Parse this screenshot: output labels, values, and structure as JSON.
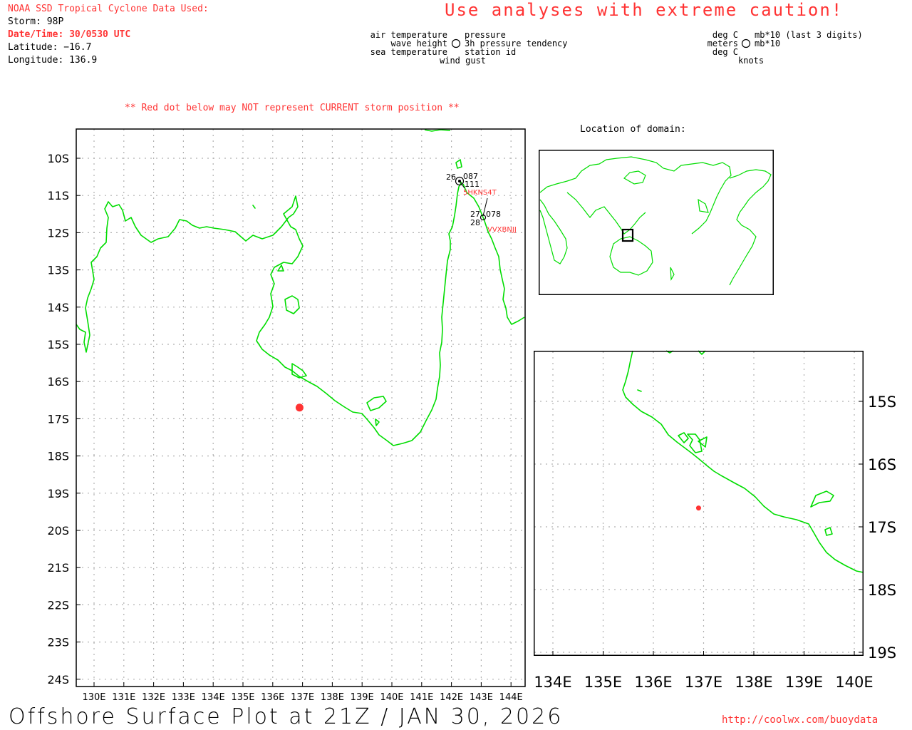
{
  "header": {
    "source_line": "NOAA SSD Tropical Cyclone Data Used:",
    "storm": "Storm: 98P",
    "datetime": "Date/Time: 30/0530 UTC",
    "latitude": "Latitude: −16.7",
    "longitude": "Longitude: 136.9",
    "caution": "Use analyses with extreme caution!",
    "red_dot_note": "** Red dot below may NOT represent CURRENT storm position **"
  },
  "legend_center": {
    "left": [
      "air temperature",
      "wave height",
      "sea temperature"
    ],
    "right": [
      "pressure",
      "3h pressure tendency",
      "station id"
    ],
    "bottom": "wind gust"
  },
  "legend_units": {
    "left": [
      "deg C",
      "meters",
      "deg C"
    ],
    "right": [
      "mb*10 (last 3 digits)",
      "mb*10"
    ],
    "bottom": "knots"
  },
  "main_map": {
    "lat_ticks": [
      "10S",
      "11S",
      "12S",
      "13S",
      "14S",
      "15S",
      "16S",
      "17S",
      "18S",
      "19S",
      "20S",
      "21S",
      "22S",
      "23S",
      "24S"
    ],
    "lon_ticks": [
      "130E",
      "131E",
      "132E",
      "133E",
      "134E",
      "135E",
      "136E",
      "137E",
      "138E",
      "139E",
      "140E",
      "141E",
      "142E",
      "143E",
      "144E"
    ],
    "storm_marker": {
      "lat": -16.7,
      "lon": 136.9,
      "color": "#ff3333"
    },
    "stations": [
      {
        "id": "5HKNS4T",
        "air_temp": "26",
        "pressure": "087",
        "tendency": "111"
      },
      {
        "id": "VVXBNJJ",
        "air_temp": "27",
        "sea_temp": "28",
        "pressure": "078"
      }
    ]
  },
  "location_map": {
    "title": "Location of domain:"
  },
  "zoom_map": {
    "lat_ticks": [
      "15S",
      "16S",
      "17S",
      "18S",
      "19S"
    ],
    "lon_ticks": [
      "134E",
      "135E",
      "136E",
      "137E",
      "138E",
      "139E",
      "140E"
    ]
  },
  "footer": {
    "title": "Offshore Surface Plot at 21Z / JAN 30, 2026",
    "url": "http://coolwx.com/buoydata"
  },
  "colors": {
    "coastline": "#00dd00",
    "accent": "#ff3333",
    "grid": "#b0b0b0"
  }
}
